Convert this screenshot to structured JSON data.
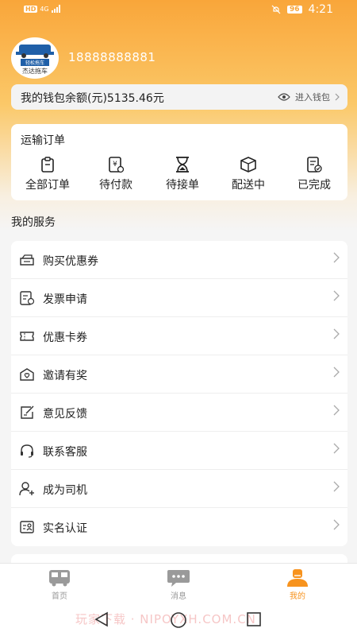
{
  "status_bar": {
    "network": "HD",
    "network_sub": "4G",
    "battery": "96",
    "time": "4:21"
  },
  "profile": {
    "avatar_top_text": "轻松拖车",
    "avatar_bottom_text": "杰达拖车",
    "phone": "18888888881"
  },
  "wallet": {
    "label": "我的钱包余额(元)5135.46元",
    "link_label": "进入钱包"
  },
  "orders": {
    "title": "运输订单",
    "items": [
      {
        "label": "全部订单",
        "icon": "clipboard-icon"
      },
      {
        "label": "待付款",
        "icon": "yen-receipt-icon"
      },
      {
        "label": "待接单",
        "icon": "hourglass-icon"
      },
      {
        "label": "配送中",
        "icon": "package-icon"
      },
      {
        "label": "已完成",
        "icon": "completed-doc-icon"
      }
    ]
  },
  "services": {
    "title": "我的服务",
    "items": [
      {
        "label": "购买优惠券",
        "icon": "coupon-purchase-icon"
      },
      {
        "label": "发票申请",
        "icon": "invoice-icon"
      },
      {
        "label": "优惠卡券",
        "icon": "ticket-icon"
      },
      {
        "label": "邀请有奖",
        "icon": "gift-envelope-icon"
      },
      {
        "label": "意见反馈",
        "icon": "feedback-icon"
      },
      {
        "label": "联系客服",
        "icon": "headset-icon"
      },
      {
        "label": "成为司机",
        "icon": "add-user-icon"
      },
      {
        "label": "实名认证",
        "icon": "id-card-icon"
      }
    ]
  },
  "tabbar": {
    "items": [
      {
        "label": "首页",
        "icon": "bus-icon",
        "active": false
      },
      {
        "label": "消息",
        "icon": "message-icon",
        "active": false
      },
      {
        "label": "我的",
        "icon": "profile-icon",
        "active": true
      }
    ]
  },
  "watermark": "玩家下载 · NIPOYXH.COM.CN",
  "colors": {
    "accent": "#f7931e",
    "hero_top": "#f9a63a",
    "hero_mid": "#fbc868"
  }
}
